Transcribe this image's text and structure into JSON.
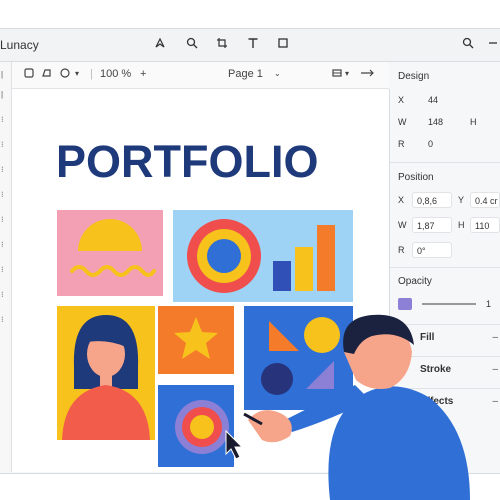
{
  "app": {
    "name": "Lunacy"
  },
  "toolbar": {
    "zoom": "100 %",
    "zoom_plus": "+",
    "page": "Page 1"
  },
  "canvas": {
    "title": "PORTFOLIO"
  },
  "inspector": {
    "design_title": "Design",
    "design": {
      "x_label": "X",
      "x_value": "44",
      "w_label": "W",
      "w_value": "148",
      "h_label": "H",
      "r_label": "R",
      "r_value": "0"
    },
    "position_title": "Position",
    "position": {
      "x_label": "X",
      "x_value": "0,8,6",
      "y_label": "Y",
      "y_value": "0.4 cr",
      "w_label": "W",
      "w_value": "1,87",
      "h_label": "H",
      "h_value": "110",
      "r_label": "R",
      "r_value": "0°"
    },
    "opacity_title": "Opacity",
    "opacity_value": "1",
    "fill_label": "Fill",
    "stroke_label": "Stroke",
    "effects_label": "Effects"
  },
  "colors": {
    "accent": "#1f3a7a",
    "pink": "#f3a0b4",
    "sky": "#9fd3f5",
    "yellow": "#f7c21b",
    "orange": "#f47b2a",
    "blue": "#2f6fd6",
    "purple": "#8b7fd6"
  }
}
